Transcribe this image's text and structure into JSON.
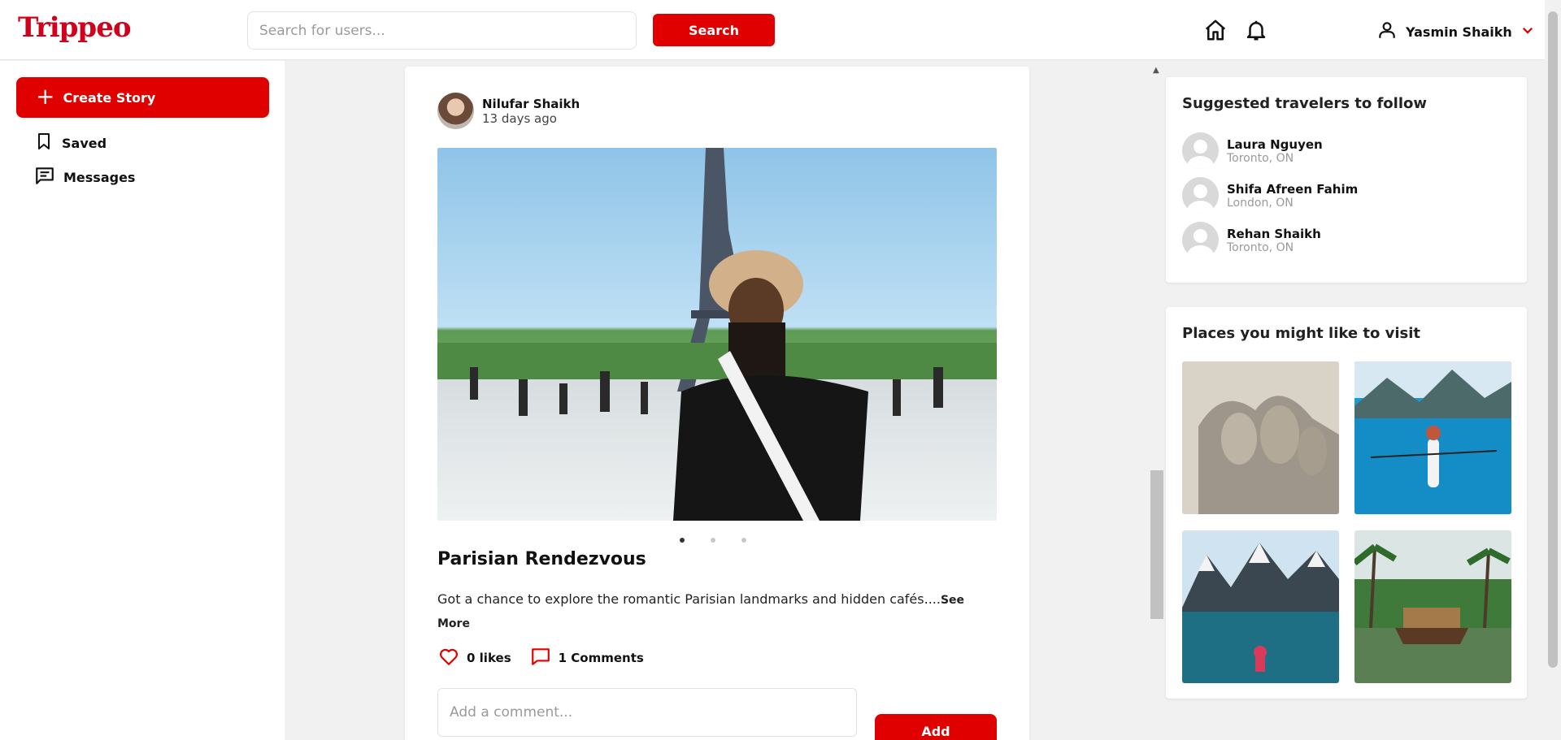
{
  "header": {
    "logo_text": "Trippeo",
    "search_placeholder": "Search for users...",
    "search_button": "Search",
    "user_name": "Yasmin Shaikh",
    "home_icon": "home-icon",
    "bell_icon": "bell-icon"
  },
  "sidebar": {
    "create_story": "Create Story",
    "items": [
      {
        "label": "Saved",
        "icon": "bookmark-icon"
      },
      {
        "label": "Messages",
        "icon": "message-icon"
      }
    ]
  },
  "post": {
    "author": "Nilufar Shaikh",
    "time": "13 days ago",
    "title": "Parisian Rendezvous",
    "description": "Got a chance to explore the romantic Parisian landmarks and hidden cafés....",
    "see_more": "See More",
    "likes": "0 likes",
    "comments": "1 Comments",
    "comment_placeholder": "Add a comment...",
    "add_button": "Add",
    "slide_count": 3,
    "active_slide": 1
  },
  "suggested": {
    "title": "Suggested travelers to follow",
    "travelers": [
      {
        "name": "Laura Nguyen",
        "location": "Toronto, ON"
      },
      {
        "name": "Shifa Afreen Fahim",
        "location": "London, ON"
      },
      {
        "name": "Rehan Shaikh",
        "location": "Toronto, ON"
      }
    ]
  },
  "places": {
    "title": "Places you might like to visit"
  },
  "colors": {
    "accent": "#e00000",
    "background": "#f1f1f1"
  }
}
